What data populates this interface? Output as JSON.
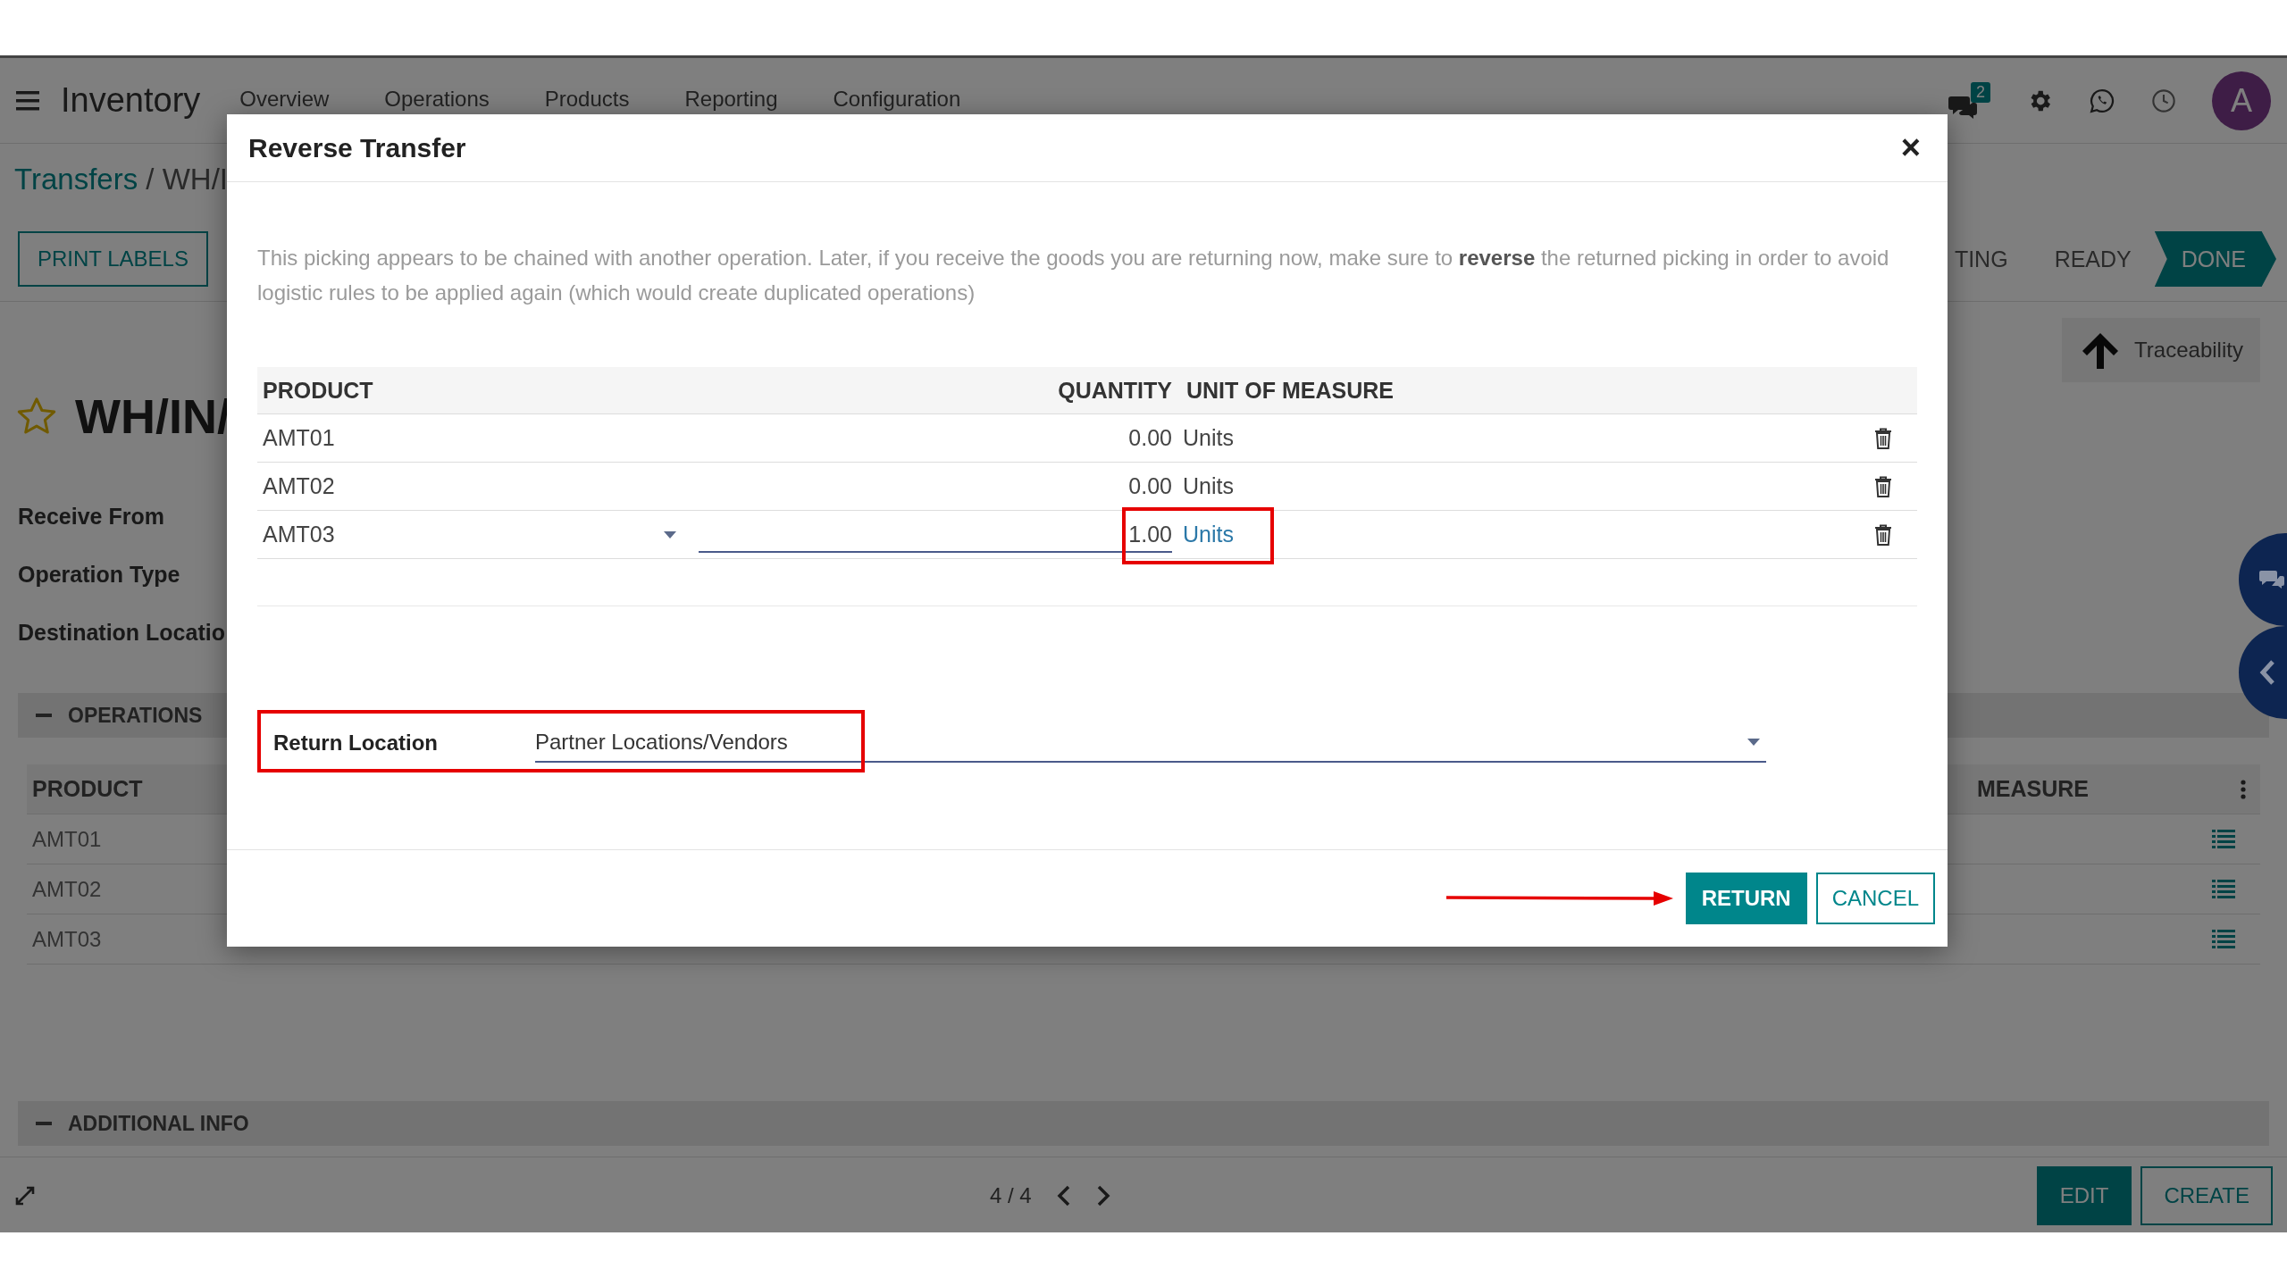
{
  "navbar": {
    "app_title": "Inventory",
    "menu": [
      "Overview",
      "Operations",
      "Products",
      "Reporting",
      "Configuration"
    ],
    "message_count": "2",
    "avatar_letter": "A"
  },
  "breadcrumb": {
    "link": "Transfers",
    "current": "/ WH/I"
  },
  "print_button": "PRINT LABELS",
  "stages": [
    {
      "label": "TING",
      "selected": false
    },
    {
      "label": "READY",
      "selected": false
    },
    {
      "label": "DONE",
      "selected": true
    }
  ],
  "traceability": "Traceability",
  "record": {
    "title": "WH/IN/",
    "starred": false
  },
  "fields": [
    "Receive From",
    "Operation Type",
    "Destination Locatio"
  ],
  "operations": {
    "heading": "OPERATIONS",
    "columns": [
      "PRODUCT",
      "MEASURE"
    ],
    "rows": [
      "AMT01",
      "AMT02",
      "AMT03"
    ]
  },
  "additional_info": "ADDITIONAL INFO",
  "pager": "4 / 4",
  "bottom_buttons": [
    {
      "label": "EDIT",
      "primary": true
    },
    {
      "label": "CREATE",
      "primary": false
    }
  ],
  "dialog": {
    "title": "Reverse Transfer",
    "close": "×",
    "message": "This picking appears to be chained with another operation. Later, if you receive the goods you are returning now, make sure to **reverse** the returned picking in order to avoid logistic rules to be applied again (which would create duplicated operations)",
    "columns": [
      "PRODUCT",
      "QUANTITY",
      "UNIT OF MEASURE"
    ],
    "lines": [
      {
        "product": "AMT01",
        "quantity": "0.00",
        "uom": "Units",
        "editing": false,
        "highlighted": false
      },
      {
        "product": "AMT02",
        "quantity": "0.00",
        "uom": "Units",
        "editing": false,
        "highlighted": false
      },
      {
        "product": "AMT03",
        "quantity": "1.00",
        "uom": "Units",
        "editing": true,
        "highlighted": true
      }
    ],
    "return_location": {
      "label": "Return Location",
      "value": "Partner Locations/Vendors",
      "highlighted": true
    },
    "buttons": [
      {
        "label": "RETURN",
        "primary": true,
        "arrow": true
      },
      {
        "label": "CANCEL",
        "primary": false,
        "arrow": false
      }
    ]
  }
}
